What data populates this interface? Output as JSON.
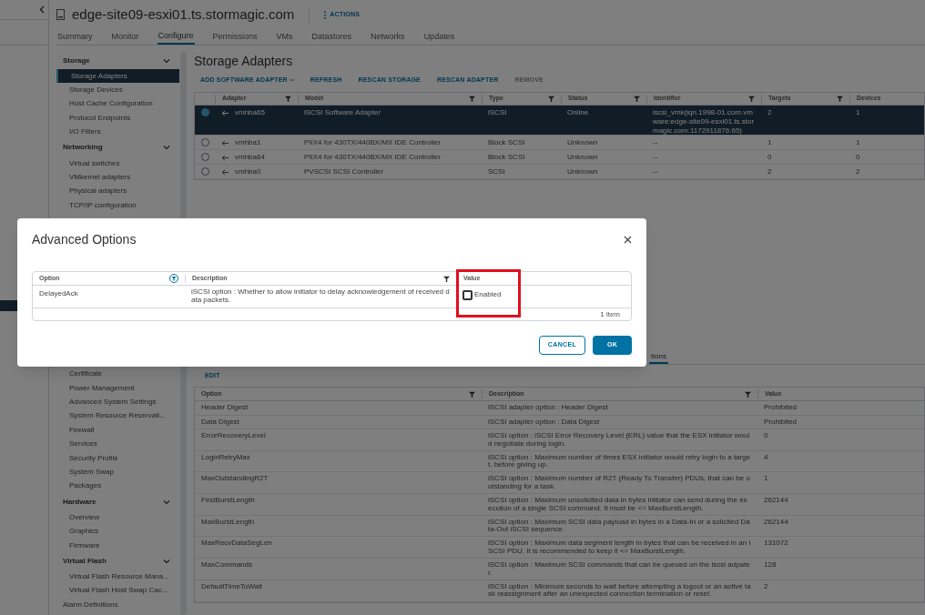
{
  "host": {
    "title": "edge-site09-esxi01.ts.stormagic.com",
    "actions": "ACTIONS"
  },
  "tabs": [
    {
      "label": "Summary",
      "selected": false
    },
    {
      "label": "Monitor",
      "selected": false
    },
    {
      "label": "Configure",
      "selected": true
    },
    {
      "label": "Permissions",
      "selected": false
    },
    {
      "label": "VMs",
      "selected": false
    },
    {
      "label": "Datastores",
      "selected": false
    },
    {
      "label": "Networks",
      "selected": false
    },
    {
      "label": "Updates",
      "selected": false
    }
  ],
  "sidebar": {
    "top": [
      {
        "kind": "header",
        "label": "Storage",
        "expanded": true
      },
      {
        "kind": "item",
        "label": "Storage Adapters",
        "selected": true
      },
      {
        "kind": "item",
        "label": "Storage Devices",
        "selected": false
      },
      {
        "kind": "item",
        "label": "Host Cache Configuration",
        "selected": false
      },
      {
        "kind": "item",
        "label": "Protocol Endpoints",
        "selected": false
      },
      {
        "kind": "item",
        "label": "I/O Filters",
        "selected": false
      },
      {
        "kind": "header",
        "label": "Networking",
        "expanded": true
      },
      {
        "kind": "item",
        "label": "Virtual switches",
        "selected": false
      },
      {
        "kind": "item",
        "label": "VMkernel adapters",
        "selected": false
      },
      {
        "kind": "item",
        "label": "Physical adapters",
        "selected": false
      },
      {
        "kind": "item",
        "label": "TCP/IP configuration",
        "selected": false
      }
    ],
    "bottom": [
      {
        "kind": "item",
        "label": "Certificate",
        "selected": false
      },
      {
        "kind": "item",
        "label": "Power Management",
        "selected": false
      },
      {
        "kind": "item",
        "label": "Advanced System Settings",
        "selected": false
      },
      {
        "kind": "item",
        "label": "System Resource Reservati...",
        "selected": false
      },
      {
        "kind": "item",
        "label": "Firewall",
        "selected": false
      },
      {
        "kind": "item",
        "label": "Services",
        "selected": false
      },
      {
        "kind": "item",
        "label": "Security Profile",
        "selected": false
      },
      {
        "kind": "item",
        "label": "System Swap",
        "selected": false
      },
      {
        "kind": "item",
        "label": "Packages",
        "selected": false
      },
      {
        "kind": "header",
        "label": "Hardware",
        "expanded": true
      },
      {
        "kind": "item",
        "label": "Overview",
        "selected": false
      },
      {
        "kind": "item",
        "label": "Graphics",
        "selected": false
      },
      {
        "kind": "item",
        "label": "Firmware",
        "selected": false
      },
      {
        "kind": "header",
        "label": "Virtual Flash",
        "expanded": true
      },
      {
        "kind": "item",
        "label": "Virtual Flash Resource Mana...",
        "selected": false
      },
      {
        "kind": "item",
        "label": "Virtual Flash Host Swap Cac...",
        "selected": false
      },
      {
        "kind": "link",
        "label": "Alarm Definitions",
        "selected": false
      }
    ]
  },
  "adapters": {
    "title": "Storage Adapters",
    "toolbar": [
      {
        "label": "ADD SOFTWARE ADAPTER",
        "kind": "dropdown",
        "disabled": false
      },
      {
        "label": "REFRESH",
        "kind": "action",
        "disabled": false
      },
      {
        "label": "RESCAN STORAGE",
        "kind": "action",
        "disabled": false
      },
      {
        "label": "RESCAN ADAPTER",
        "kind": "action",
        "disabled": false
      },
      {
        "label": "REMOVE",
        "kind": "action",
        "disabled": true
      }
    ],
    "columns": [
      {
        "label": "Adapter",
        "filter": true
      },
      {
        "label": "Model",
        "filter": true
      },
      {
        "label": "Type",
        "filter": true
      },
      {
        "label": "Status",
        "filter": true
      },
      {
        "label": "Identifier",
        "filter": true
      },
      {
        "label": "Targets",
        "filter": true
      },
      {
        "label": "Devices",
        "filter": false
      }
    ],
    "rows": [
      {
        "selected": true,
        "cells": [
          "vmhba65",
          "iSCSI Software Adapter",
          "iSCSI",
          "Online",
          "iscsi_vmk(iqn.1998-01.com.vmware:edge-site09-esxi01.ts.stormagic.com:1172911876:65)",
          "2",
          "1"
        ]
      },
      {
        "selected": false,
        "cells": [
          "vmhba1",
          "PIIX4 for 430TX/440BX/MX IDE Controller",
          "Block SCSI",
          "Unknown",
          "--",
          "1",
          "1"
        ]
      },
      {
        "selected": false,
        "cells": [
          "vmhba64",
          "PIIX4 for 430TX/440BX/MX IDE Controller",
          "Block SCSI",
          "Unknown",
          "--",
          "0",
          "0"
        ]
      },
      {
        "selected": false,
        "cells": [
          "vmhba0",
          "PVSCSI SCSI Controller",
          "SCSI",
          "Unknown",
          "--",
          "2",
          "2"
        ]
      }
    ]
  },
  "details": {
    "tabs": [
      {
        "label": "tions",
        "selected": true
      }
    ],
    "edit": "EDIT",
    "columns": [
      {
        "label": "Option",
        "filter": true
      },
      {
        "label": "Description",
        "filter": true
      },
      {
        "label": "Value",
        "filter": false
      }
    ],
    "rows": [
      [
        "Header Digest",
        "iSCSI adapter option : Header Digest",
        "Prohibited"
      ],
      [
        "Data Digest",
        "iSCSI adapter option : Data Digest",
        "Prohibited"
      ],
      [
        "ErrorRecoveryLevel",
        "iSCSI option : iSCSI Error Recovery Level (ERL) value that the ESX initiator would negotiate during login.",
        "0"
      ],
      [
        "LoginRetryMax",
        "iSCSI option : Maximum number of times ESX initiator would retry login to a target, before giving up.",
        "4"
      ],
      [
        "MaxOutstandingR2T",
        "iSCSI option : Maximum number of R2T (Ready To Transfer) PDUs, that can be outstanding for a task.",
        "1"
      ],
      [
        "FirstBurstLength",
        "iSCSI option : Maximum unsolicited data in bytes initiator can send during the execution of a single SCSI command. It must be <= MaxBurstLength.",
        "262144"
      ],
      [
        "MaxBurstLength",
        "iSCSI option : Maximum SCSI data payload in bytes in a Data-In or a solicited Data-Out iSCSI sequence.",
        "262144"
      ],
      [
        "MaxRecvDataSegLen",
        "iSCSI option : Maximum data segment length in bytes that can be received in an iSCSI PDU. It is recommended to keep it <= MaxBurstLength.",
        "131072"
      ],
      [
        "MaxCommands",
        "iSCSI option : Maximum SCSI commands that can be queued on the iscsi adpater.",
        "128"
      ],
      [
        "DefaultTimeToWait",
        "iSCSI option : Minimum seconds to wait before attempting a logout or an active task reassignment after an unexpected connection termination or reset.",
        "2"
      ]
    ]
  },
  "dialog": {
    "title": "Advanced Options",
    "columns": [
      {
        "label": "Option",
        "filter": true,
        "filter_active": true
      },
      {
        "label": "Description",
        "filter": true,
        "filter_active": false
      },
      {
        "label": "Value",
        "filter": false
      }
    ],
    "value_column_highlighted": true,
    "rows": [
      {
        "option": "DelayedAck",
        "description": "iSCSI option : Whether to allow initiator to delay acknowledgement of received data packets.",
        "checked": false,
        "value_label": "Enabled"
      }
    ],
    "footer": "1 item",
    "buttons": [
      {
        "label": "CANCEL",
        "kind": "secondary"
      },
      {
        "label": "OK",
        "kind": "primary"
      }
    ]
  }
}
